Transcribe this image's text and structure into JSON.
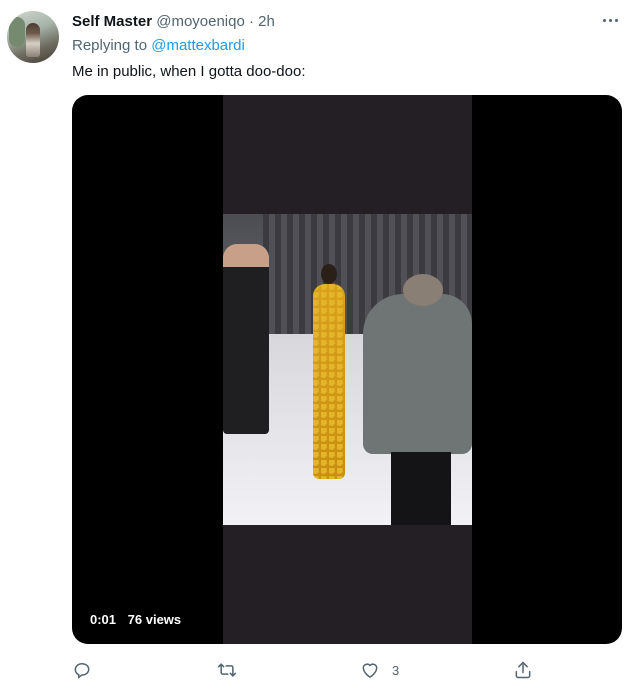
{
  "tweet": {
    "display_name": "Self Master",
    "handle": "@moyoeniqo",
    "separator": "·",
    "time": "2h",
    "replying_prefix": "Replying to",
    "replying_handle": "@mattexbardi",
    "text": "Me in public, when I gotta doo-doo:"
  },
  "video": {
    "timestamp": "0:01",
    "views": "76 views"
  },
  "actions": {
    "reply_icon": "reply-icon",
    "retweet_icon": "retweet-icon",
    "like_icon": "heart-icon",
    "like_count": "3",
    "share_icon": "share-icon"
  },
  "colors": {
    "link": "#1d9bf0",
    "muted": "#536471",
    "text": "#0f1419"
  }
}
